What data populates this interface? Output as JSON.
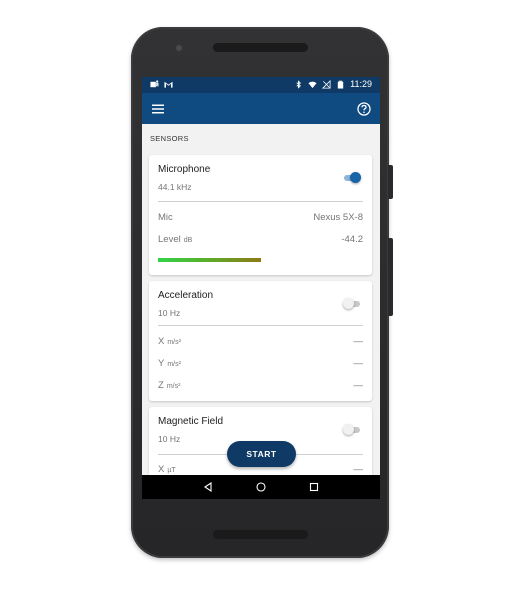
{
  "status_bar": {
    "time": "11:29",
    "left_icons": [
      "teams-icon",
      "gmail-icon"
    ],
    "right_icons": [
      "bluetooth-icon",
      "wifi-icon",
      "no-signal-icon",
      "battery-icon"
    ]
  },
  "app_bar": {
    "menu_icon": "menu-icon",
    "help_icon": "help-icon"
  },
  "sensors": {
    "section_title": "SENSORS",
    "microphone": {
      "title": "Microphone",
      "rate": "44.1 kHz",
      "enabled": true,
      "rows": [
        {
          "label": "Mic",
          "unit": "",
          "value": "Nexus 5X-8"
        },
        {
          "label": "Level",
          "unit": "dB",
          "value": "-44.2"
        }
      ],
      "level_fraction": 0.5
    },
    "acceleration": {
      "title": "Acceleration",
      "rate": "10 Hz",
      "enabled": false,
      "rows": [
        {
          "label": "X",
          "unit": "m/s²",
          "value": "—"
        },
        {
          "label": "Y",
          "unit": "m/s²",
          "value": "—"
        },
        {
          "label": "Z",
          "unit": "m/s²",
          "value": "—"
        }
      ]
    },
    "magnetic_field": {
      "title": "Magnetic Field",
      "rate": "10 Hz",
      "enabled": false,
      "rows": [
        {
          "label": "X",
          "unit": "µT",
          "value": "—"
        }
      ]
    }
  },
  "fab": {
    "label": "START"
  },
  "colors": {
    "primary_dark": "#0f3a66",
    "primary": "#0f4a80",
    "accent": "#1565a8"
  }
}
